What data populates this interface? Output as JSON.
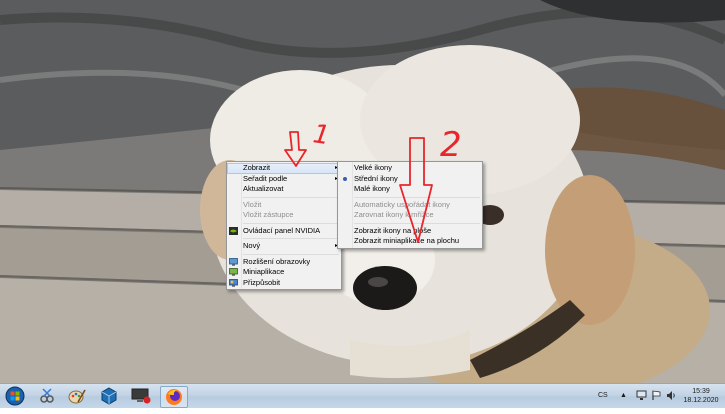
{
  "context_menu": {
    "items": [
      {
        "label": "Zobrazit",
        "submenu": true,
        "state": "hover"
      },
      {
        "label": "Seřadit podle",
        "submenu": true
      },
      {
        "label": "Aktualizovat"
      },
      {
        "separator": true
      },
      {
        "label": "Vložit",
        "disabled": true
      },
      {
        "label": "Vložit zástupce",
        "disabled": true
      },
      {
        "separator": true
      },
      {
        "label": "Ovládací panel NVIDIA",
        "icon": "nvidia-icon"
      },
      {
        "separator": true
      },
      {
        "label": "Nový",
        "submenu": true
      },
      {
        "separator": true
      },
      {
        "label": "Rozlišení obrazovky",
        "icon": "display-icon"
      },
      {
        "label": "Miniaplikace",
        "icon": "gadgets-icon"
      },
      {
        "label": "Přizpůsobit",
        "icon": "personalize-icon"
      }
    ]
  },
  "submenu": {
    "items": [
      {
        "label": "Velké ikony"
      },
      {
        "label": "Střední ikony",
        "selected": true
      },
      {
        "label": "Malé ikony"
      },
      {
        "separator": true
      },
      {
        "label": "Automaticky uspořádat ikony",
        "disabled": true
      },
      {
        "label": "Zarovnat ikony k mřížce",
        "disabled": true
      },
      {
        "separator": true
      },
      {
        "label": "Zobrazit ikony na ploše"
      },
      {
        "label": "Zobrazit miniaplikace na plochu"
      }
    ]
  },
  "annotations": {
    "number_1": "1",
    "number_2": "2",
    "color": "#e8262b"
  },
  "taskbar": {
    "buttons": [
      "start-orb-icon",
      "snipping-tool-icon",
      "paint-icon",
      "virtualbox-icon",
      "remote-desktop-icon",
      "firefox-icon"
    ],
    "language": "CS",
    "time": "15:39",
    "date": "18.12.2020"
  }
}
